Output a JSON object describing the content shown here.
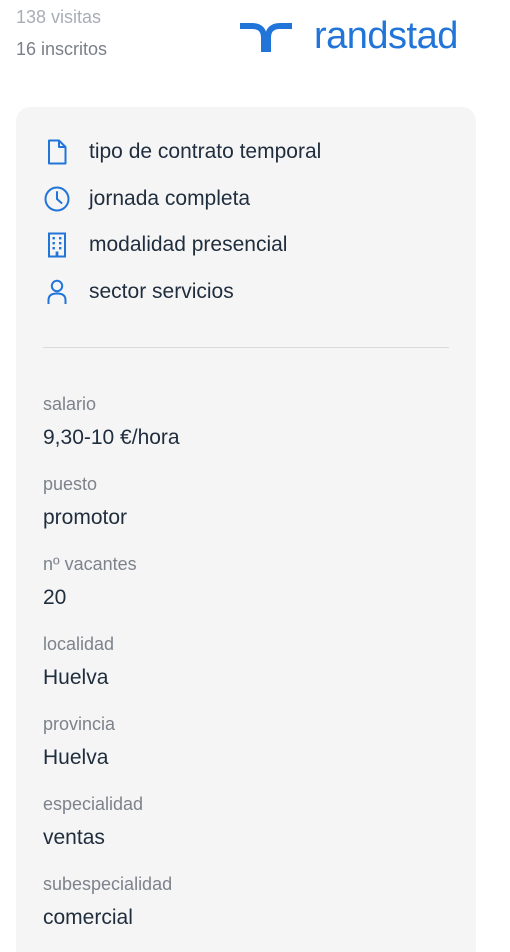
{
  "stats": {
    "visits": "138 visitas",
    "enrolled": "16 inscritos"
  },
  "brand": {
    "name": "randstad",
    "color": "#2175d9"
  },
  "features": [
    {
      "icon": "document-icon",
      "label": "tipo de contrato temporal"
    },
    {
      "icon": "clock-icon",
      "label": "jornada completa"
    },
    {
      "icon": "building-icon",
      "label": "modalidad presencial"
    },
    {
      "icon": "person-icon",
      "label": "sector servicios"
    }
  ],
  "details": [
    {
      "label": "salario",
      "value": "9,30-10 €/hora"
    },
    {
      "label": "puesto",
      "value": "promotor"
    },
    {
      "label": "nº vacantes",
      "value": "20"
    },
    {
      "label": "localidad",
      "value": "Huelva"
    },
    {
      "label": "provincia",
      "value": "Huelva"
    },
    {
      "label": "especialidad",
      "value": "ventas"
    },
    {
      "label": "subespecialidad",
      "value": "comercial"
    }
  ]
}
